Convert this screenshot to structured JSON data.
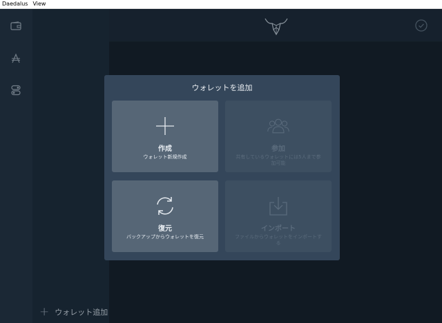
{
  "menubar": {
    "items": [
      "Daedalus",
      "View"
    ]
  },
  "sidebar": {
    "icons": [
      "wallet-icon",
      "ada-icon",
      "settings-icon"
    ]
  },
  "wallets_panel": {
    "add_wallet_label": "ウォレット追加"
  },
  "topbar": {
    "logo": "daedalus-bull-logo-icon",
    "sync": "sync-check-icon"
  },
  "dialog": {
    "title": "ウォレットを追加",
    "cards": [
      {
        "id": "create",
        "label": "作成",
        "description": "ウォレット新規作成",
        "icon": "plus-icon",
        "enabled": true
      },
      {
        "id": "join",
        "label": "参加",
        "description": "共有しているウォレットには5人まで参加可能",
        "icon": "people-icon",
        "enabled": false
      },
      {
        "id": "restore",
        "label": "復元",
        "description": "バックアップからウォレットを復元",
        "icon": "refresh-icon",
        "enabled": true
      },
      {
        "id": "import",
        "label": "インポート",
        "description": "ファイルからウォレットをインポートする",
        "icon": "import-icon",
        "enabled": false
      }
    ]
  },
  "colors": {
    "sidebar": "#202f3e",
    "wallets_panel": "#1a2735",
    "topbar": "#1a2532",
    "dialog": "#34465a",
    "card_active": "#566676",
    "card_disabled": "#3d4f61"
  }
}
